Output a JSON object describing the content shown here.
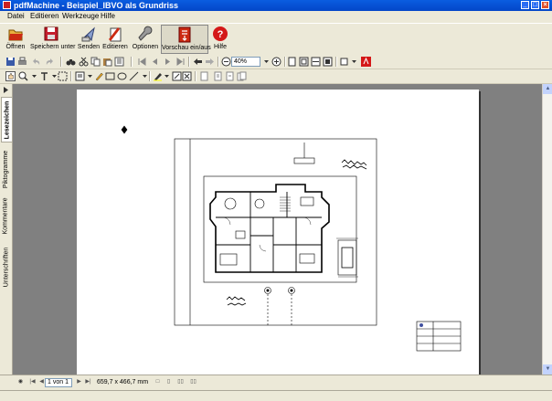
{
  "window": {
    "title": "pdfMachine - Beispiel_IBVO als Grundriss"
  },
  "menu": [
    "Datei",
    "Editieren",
    "Werkzeuge",
    "Hilfe"
  ],
  "main_toolbar": {
    "buttons": [
      {
        "label": "Öffnen",
        "icon": "open-folder-icon",
        "color": "#cc2a12"
      },
      {
        "label": "Speichern unter",
        "icon": "save-disk-icon",
        "color": "#c41e2e"
      },
      {
        "label": "Senden",
        "icon": "send-icon",
        "color": "#4060a0"
      },
      {
        "label": "Editieren",
        "icon": "edit-document-icon",
        "color": "#cc2a12"
      },
      {
        "label": "Optionen",
        "icon": "wrench-icon",
        "color": "#5a5a5a"
      },
      {
        "label": "Vorschau ein/aus",
        "icon": "preview-toggle-icon",
        "color": "#cc2a12",
        "pressed": true
      },
      {
        "label": "Hilfe",
        "icon": "help-icon",
        "color": "#d41818"
      }
    ]
  },
  "zoom": {
    "value": "40%"
  },
  "side_tabs": [
    {
      "label": "Lesezeichen",
      "active": true
    },
    {
      "label": "Piktogramme",
      "active": false
    },
    {
      "label": "Kommentare",
      "active": false
    },
    {
      "label": "Unterschriften",
      "active": false
    }
  ],
  "status": {
    "page": "1 von 1",
    "dimensions": "659,7 x 466,7 mm"
  }
}
